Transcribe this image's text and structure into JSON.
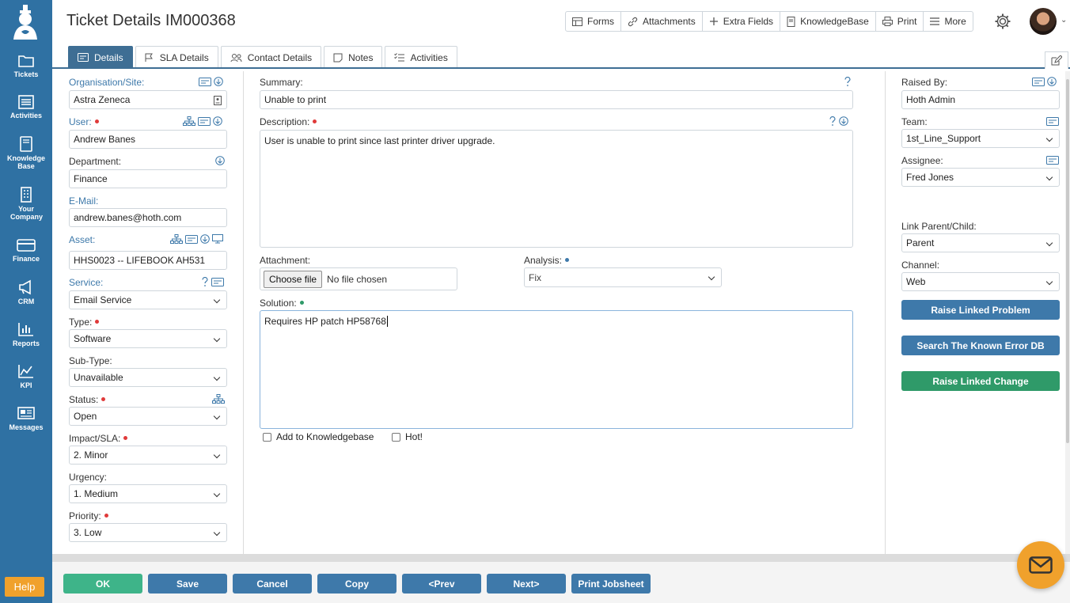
{
  "header": {
    "title": "Ticket Details IM000368",
    "toolbar": [
      "Forms",
      "Attachments",
      "Extra Fields",
      "KnowledgeBase",
      "Print",
      "More"
    ]
  },
  "sidebar": {
    "items": [
      {
        "label": "Tickets",
        "icon": "folder-icon"
      },
      {
        "label": "Activities",
        "icon": "list-icon"
      },
      {
        "label": "Knowledge Base",
        "icon": "book-icon"
      },
      {
        "label": "Your Company",
        "icon": "building-icon"
      },
      {
        "label": "Finance",
        "icon": "card-icon"
      },
      {
        "label": "CRM",
        "icon": "megaphone-icon"
      },
      {
        "label": "Reports",
        "icon": "bar-chart-icon"
      },
      {
        "label": "KPI",
        "icon": "area-chart-icon"
      },
      {
        "label": "Messages",
        "icon": "newspaper-icon"
      }
    ],
    "help": "Help"
  },
  "tabs": [
    "Details",
    "SLA Details",
    "Contact Details",
    "Notes",
    "Activities"
  ],
  "left": {
    "organisation": {
      "label": "Organisation/Site:",
      "value": "Astra Zeneca"
    },
    "user": {
      "label": "User:",
      "value": "Andrew Banes"
    },
    "department": {
      "label": "Department:",
      "value": "Finance"
    },
    "email": {
      "label": "E-Mail:",
      "value": "andrew.banes@hoth.com"
    },
    "asset": {
      "label": "Asset:",
      "value": "HHS0023 -- LIFEBOOK AH531"
    },
    "service": {
      "label": "Service:",
      "value": "Email Service"
    },
    "type": {
      "label": "Type:",
      "value": "Software"
    },
    "subtype": {
      "label": "Sub-Type:",
      "value": "Unavailable"
    },
    "status": {
      "label": "Status:",
      "value": "Open"
    },
    "impact": {
      "label": "Impact/SLA:",
      "value": "2. Minor"
    },
    "urgency": {
      "label": "Urgency:",
      "value": "1. Medium"
    },
    "priority": {
      "label": "Priority:",
      "value": "3. Low"
    }
  },
  "middle": {
    "summary": {
      "label": "Summary:",
      "value": "Unable to print"
    },
    "description": {
      "label": "Description:",
      "value": "User is unable to print since last printer driver upgrade."
    },
    "attachment": {
      "label": "Attachment:",
      "button": "Choose file",
      "status": "No file chosen"
    },
    "analysis": {
      "label": "Analysis:",
      "value": "Fix"
    },
    "solution": {
      "label": "Solution:",
      "value": "Requires HP patch HP58768"
    },
    "add_kb": "Add to Knowledgebase",
    "hot": "Hot!"
  },
  "right": {
    "raised_by": {
      "label": "Raised By:",
      "value": "Hoth Admin"
    },
    "team": {
      "label": "Team:",
      "value": "1st_Line_Support"
    },
    "assignee": {
      "label": "Assignee:",
      "value": "Fred Jones"
    },
    "link": {
      "label": "Link Parent/Child:",
      "value": "Parent"
    },
    "channel": {
      "label": "Channel:",
      "value": "Web"
    },
    "buttons": [
      "Raise Linked Problem",
      "Search The Known Error DB",
      "Raise Linked Change"
    ]
  },
  "footer": [
    "OK",
    "Save",
    "Cancel",
    "Copy",
    "<Prev",
    "Next>",
    "Print Jobsheet"
  ],
  "colors": {
    "sidebar": "#2f71a3",
    "accent": "#3e79aa",
    "green": "#3eb489",
    "orange": "#f0a12c",
    "required": "#e03a3a"
  }
}
